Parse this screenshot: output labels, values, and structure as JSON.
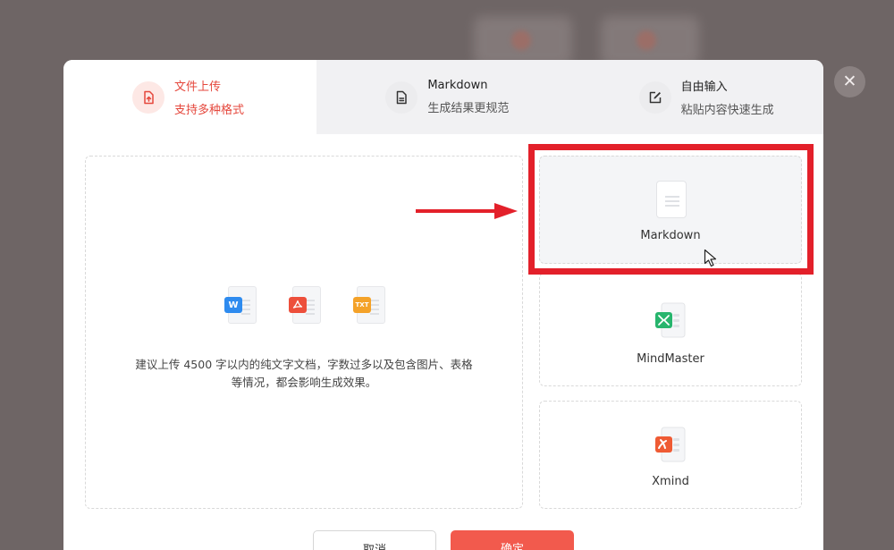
{
  "dialog": {
    "close_icon": "close-icon",
    "tabs": [
      {
        "title": "文件上传",
        "subtitle": "支持多种格式",
        "icon": "upload-file-icon",
        "active": true
      },
      {
        "title": "Markdown",
        "subtitle": "生成结果更规范",
        "icon": "document-icon",
        "active": false
      },
      {
        "title": "自由输入",
        "subtitle": "粘贴内容快速生成",
        "icon": "edit-icon",
        "active": false
      }
    ],
    "upload": {
      "file_types": [
        {
          "label": "W",
          "icon": "word-file-icon"
        },
        {
          "label": "PDF",
          "icon": "pdf-file-icon"
        },
        {
          "label": "TXT",
          "icon": "txt-file-icon"
        }
      ],
      "hint_line1": "建议上传 4500 字以内的纯文字文档，字数过多以及包含图片、表格",
      "hint_line2": "等情况，都会影响生成效果。"
    },
    "formats": [
      {
        "label": "Markdown",
        "icon": "markdown-file-icon",
        "selected": true
      },
      {
        "label": "MindMaster",
        "icon": "mindmaster-file-icon",
        "selected": false
      },
      {
        "label": "Xmind",
        "icon": "xmind-file-icon",
        "selected": false
      }
    ],
    "buttons": {
      "cancel": "取消",
      "confirm": "确定"
    }
  },
  "colors": {
    "accent": "#e5473c",
    "confirm_button": "#f25a4d",
    "annotation_red": "#e3202a",
    "overlay": "#6e6565"
  }
}
